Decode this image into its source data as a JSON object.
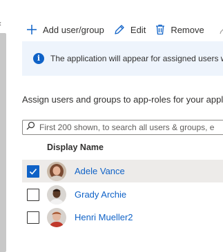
{
  "toolbar": {
    "add_label": "Add user/group",
    "edit_label": "Edit",
    "remove_label": "Remove"
  },
  "banner": {
    "text": "The application will appear for assigned users w"
  },
  "assign_text": "Assign users and groups to app-roles for your appl",
  "search": {
    "text": "First 200 shown, to search all users & groups, e"
  },
  "table": {
    "column_header": "Display Name",
    "rows": [
      {
        "name": "Adele Vance",
        "checked": true
      },
      {
        "name": "Grady Archie",
        "checked": false
      },
      {
        "name": "Henri Mueller2",
        "checked": false
      }
    ]
  },
  "colors": {
    "accent": "#0f62c7",
    "banner_bg": "#eef4fc",
    "selected_row_bg": "#edebe9"
  }
}
